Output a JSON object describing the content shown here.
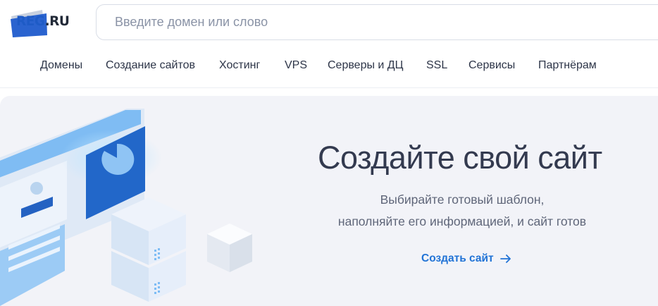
{
  "header": {
    "logo": {
      "brand": "REG",
      "tld": ".RU"
    },
    "search": {
      "placeholder": "Введите домен или слово",
      "value": ""
    }
  },
  "nav": {
    "items": [
      {
        "label": "Домены"
      },
      {
        "label": "Создание сайтов"
      },
      {
        "label": "Хостинг"
      },
      {
        "label": "VPS"
      },
      {
        "label": "Серверы и ДЦ"
      },
      {
        "label": "SSL"
      },
      {
        "label": "Сервисы"
      },
      {
        "label": "Партнёрам"
      }
    ]
  },
  "hero": {
    "title": "Создайте свой сайт",
    "subtitle_line1": "Выбирайте готовый шаблон,",
    "subtitle_line2": "наполняйте его информацией, и сайт готов",
    "cta_label": "Создать сайт",
    "cta_icon": "arrow-right-icon"
  },
  "colors": {
    "brand_blue": "#1e5bc6",
    "link_blue": "#2173d6",
    "hero_bg": "#f2f3f8",
    "text_dark": "#333a4f",
    "text_muted": "#5f6679"
  }
}
